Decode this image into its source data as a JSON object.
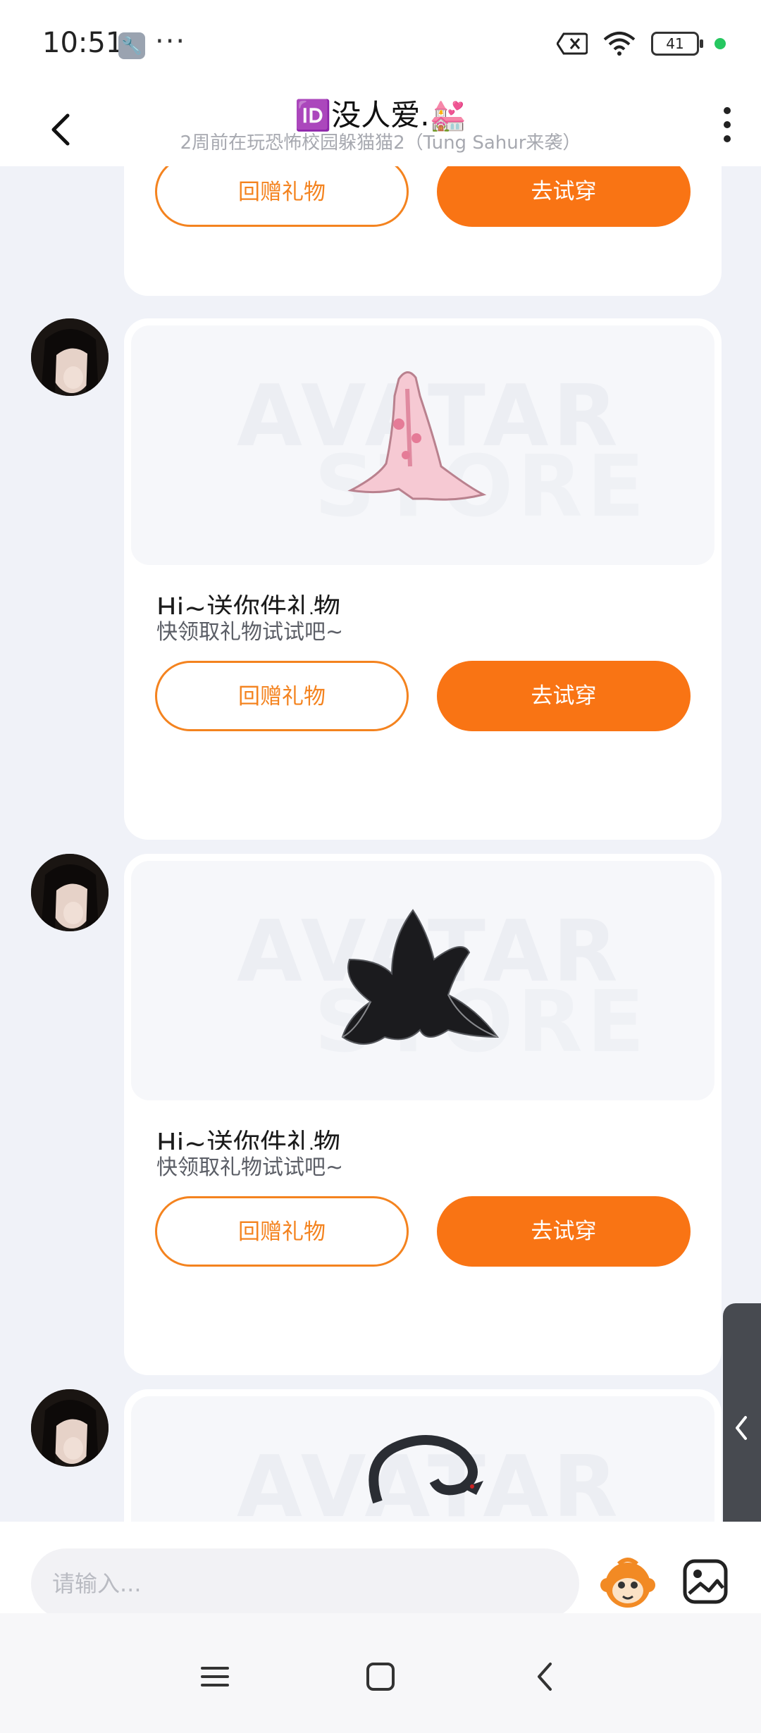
{
  "status_bar": {
    "time": "10:51",
    "battery": "41",
    "icons": [
      "wrench-icon",
      "more-dots-icon",
      "notification-off-icon",
      "wifi-icon",
      "battery-icon",
      "green-dot-indicator"
    ]
  },
  "header": {
    "title": "🆔没人爱.💒",
    "subtitle": "2周前在玩恐怖校园躲猫猫2（Tung Sahur来袭）"
  },
  "messages": [
    {
      "type": "gift",
      "return_label": "回赠礼物",
      "try_label": "去试穿",
      "partial": "top"
    },
    {
      "type": "gift",
      "item": "pink-sakura-gown",
      "title": "Hi~送你件礼物",
      "subtitle": "快领取礼物试试吧~",
      "return_label": "回赠礼物",
      "try_label": "去试穿"
    },
    {
      "type": "gift",
      "item": "black-lily-flower",
      "title": "Hi~送你件礼物",
      "subtitle": "快领取礼物试试吧~",
      "return_label": "回赠礼物",
      "try_label": "去试穿"
    },
    {
      "type": "gift",
      "item": "dark-dragon",
      "partial": "bottom"
    }
  ],
  "watermark": {
    "line1": "AVATAR",
    "line2": "STORE"
  },
  "input": {
    "placeholder": "请输入..."
  },
  "colors": {
    "accent": "#f97414",
    "accent_outline": "#f4831f",
    "background": "#f0f2f8"
  }
}
